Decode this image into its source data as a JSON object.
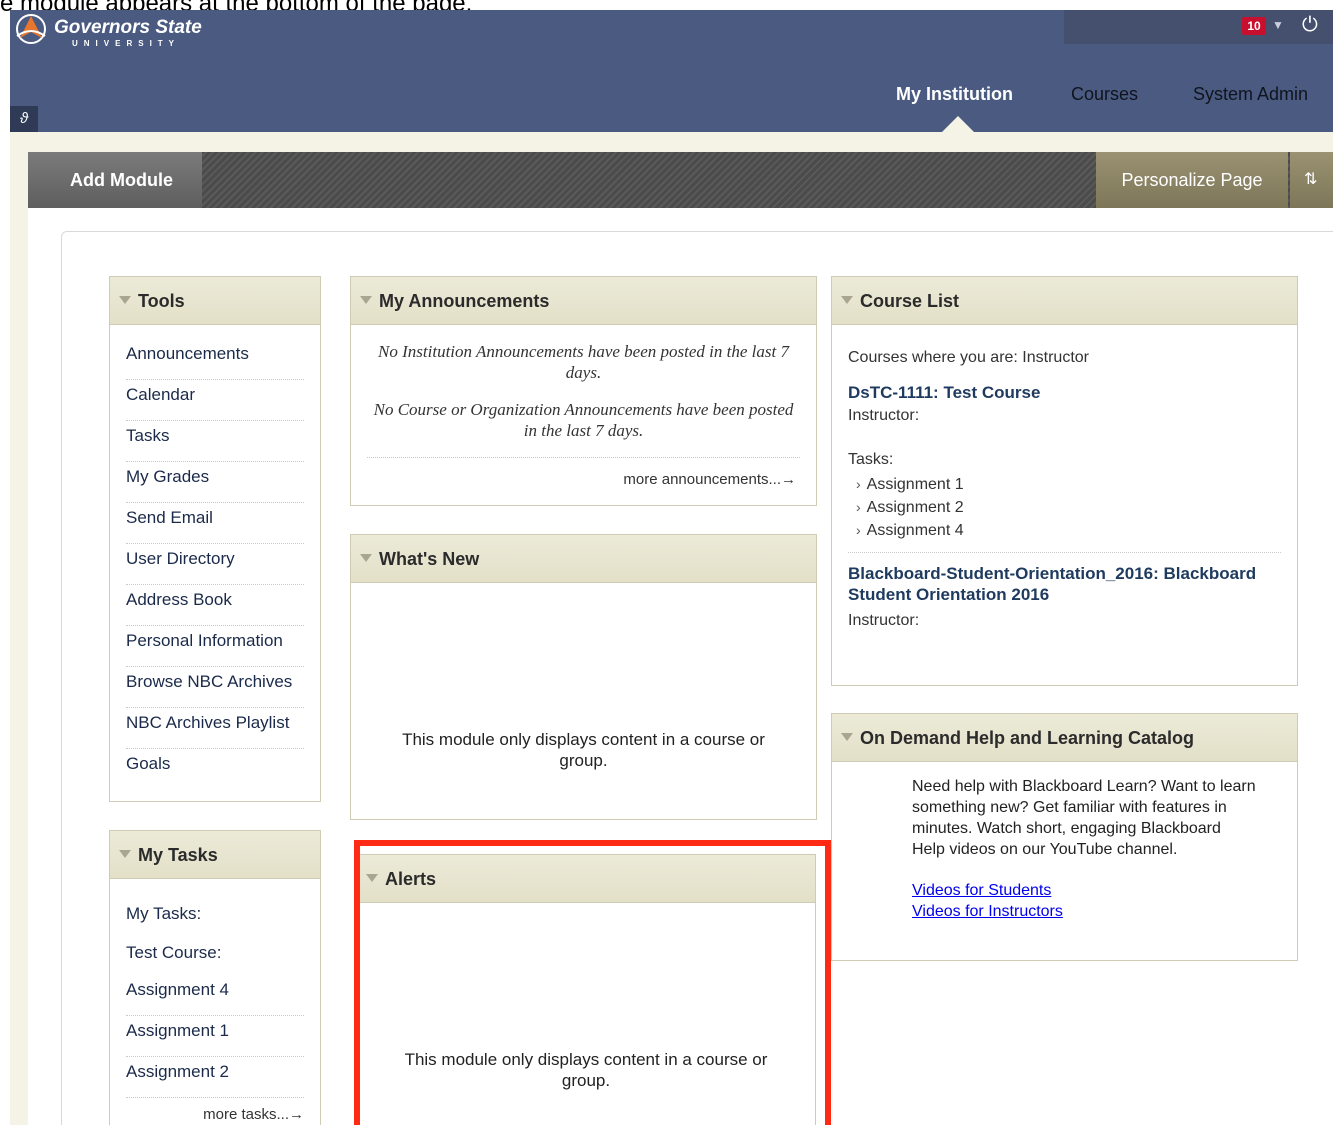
{
  "caption": "e module appears at the bottom of the page.",
  "header": {
    "logo_title": "Governors State",
    "logo_subtitle": "UNIVERSITY",
    "notification_count": "10",
    "tabs": [
      {
        "label": "My Institution",
        "active": true
      },
      {
        "label": "Courses",
        "active": false
      },
      {
        "label": "System Admin",
        "active": false
      }
    ]
  },
  "toolbar": {
    "add_module": "Add Module",
    "personalize": "Personalize Page",
    "reorder": "⇅"
  },
  "tools": {
    "title": "Tools",
    "items": [
      "Announcements",
      "Calendar",
      "Tasks",
      "My Grades",
      "Send Email",
      "User Directory",
      "Address Book",
      "Personal Information",
      "Browse NBC Archives",
      "NBC Archives Playlist",
      "Goals"
    ]
  },
  "my_tasks": {
    "title": "My Tasks",
    "heading": "My Tasks:",
    "course": "Test Course:",
    "items": [
      "Assignment 4",
      "Assignment 1",
      "Assignment 2"
    ],
    "more": "more tasks...→"
  },
  "announcements": {
    "title": "My Announcements",
    "institution_msg": "No Institution Announcements have been posted in the last 7 days.",
    "course_msg": "No Course or Organization Announcements have been posted in the last 7 days.",
    "more": "more announcements...→"
  },
  "whats_new": {
    "title": "What's New",
    "message": "This module only displays content in a course or group."
  },
  "alerts": {
    "title": "Alerts",
    "message": "This module only displays content in a course or group."
  },
  "course_list": {
    "title": "Course List",
    "role_line": "Courses where you are: Instructor",
    "course1": "DsTC-1111: Test Course",
    "instructor_label": "Instructor:",
    "tasks_label": "Tasks:",
    "tasks": [
      "Assignment 1",
      "Assignment 2",
      "Assignment 4"
    ],
    "course2": "Blackboard-Student-Orientation_2016: Blackboard Student Orientation 2016",
    "instructor_label2": "Instructor:"
  },
  "help": {
    "title": "On Demand Help and Learning Catalog",
    "text": "Need help with Blackboard Learn? Want to learn something new? Get familiar with features in minutes. Watch short, engaging Blackboard Help videos on our YouTube channel.",
    "link_students": "Videos for Students",
    "link_instructors": "Videos for Instructors"
  },
  "colors": {
    "header_bg": "#4a5a80",
    "module_head": "#e6e3cc",
    "highlight": "#ff2a14"
  }
}
